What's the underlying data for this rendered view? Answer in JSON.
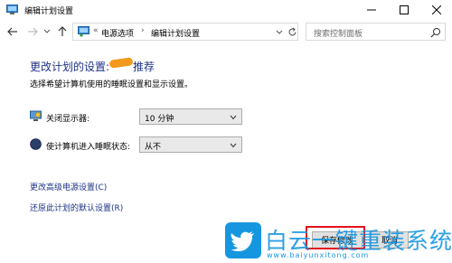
{
  "window": {
    "title": "编辑计划设置"
  },
  "navigation": {
    "breadcrumb_prefix": "«",
    "breadcrumb": [
      "电源选项",
      "编辑计划设置"
    ],
    "breadcrumb_separator": "›",
    "search_placeholder": "搜索控制面板"
  },
  "main": {
    "title": "更改计划的设置:",
    "title_suffix": "推荐",
    "subtitle": "选择希望计算机使用的睡眠设置和显示设置。",
    "settings": [
      {
        "label": "关闭显示器:",
        "value": "10 分钟",
        "icon": "monitor-icon"
      },
      {
        "label": "使计算机进入睡眠状态:",
        "value": "从不",
        "icon": "moon-sleep-icon"
      }
    ],
    "links": [
      "更改高级电源设置(C)",
      "还原此计划的默认设置(R)"
    ]
  },
  "footer": {
    "save_label": "保存修改",
    "cancel_label": "取消"
  },
  "watermark": {
    "text": "白云一键重装系统",
    "url": "www.baiyunxitong.com"
  },
  "colors": {
    "link": "#1e3287",
    "highlight_box": "#e0141e",
    "watermark": "#1796e0",
    "orange_redaction": "#f39a1e"
  }
}
